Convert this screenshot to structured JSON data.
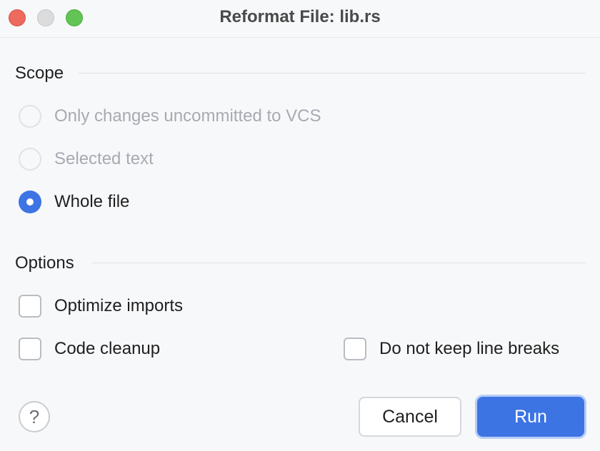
{
  "window": {
    "title": "Reformat File: lib.rs"
  },
  "scope": {
    "label": "Scope",
    "options": [
      {
        "label": "Only changes uncommitted to VCS",
        "enabled": false,
        "selected": false
      },
      {
        "label": "Selected text",
        "enabled": false,
        "selected": false
      },
      {
        "label": "Whole file",
        "enabled": true,
        "selected": true
      }
    ]
  },
  "options": {
    "label": "Options",
    "optimize_imports": {
      "label": "Optimize imports",
      "checked": false
    },
    "code_cleanup": {
      "label": "Code cleanup",
      "checked": false
    },
    "do_not_keep_line_breaks": {
      "label": "Do not keep line breaks",
      "checked": false
    }
  },
  "footer": {
    "help_glyph": "?",
    "cancel_label": "Cancel",
    "run_label": "Run"
  },
  "colors": {
    "accent": "#3d74e4",
    "disabled_text": "#a7aab1",
    "background": "#f7f8fa"
  }
}
